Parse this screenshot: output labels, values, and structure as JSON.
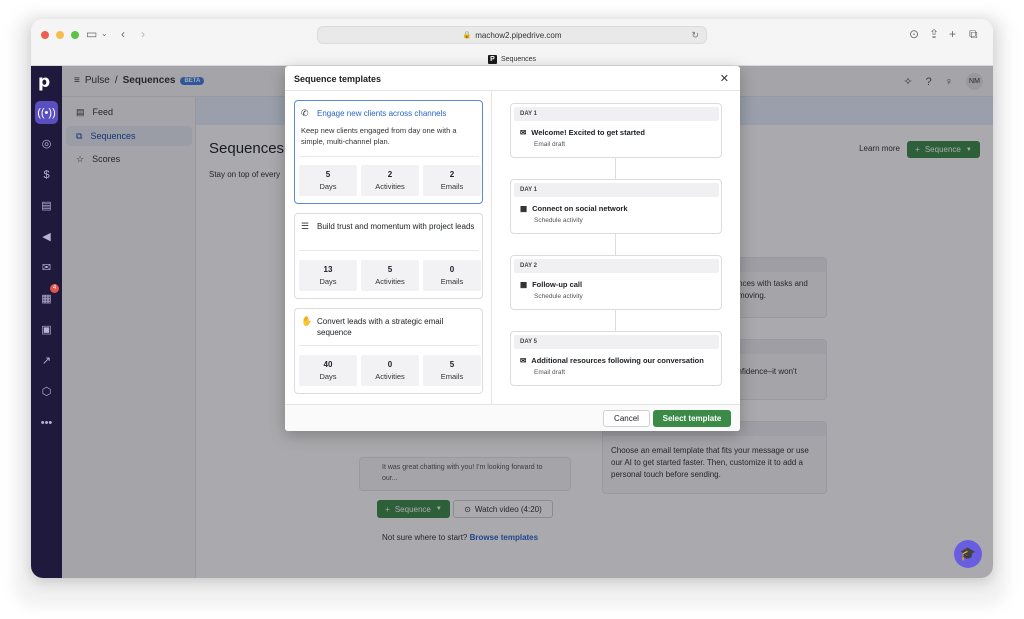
{
  "browser": {
    "url": "machow2.pipedrive.com",
    "tab_title": "Sequences",
    "favicon_letter": "P"
  },
  "colors": {
    "accent": "#3c8a47",
    "rail": "#1f1a3d",
    "link": "#2a63c7"
  },
  "rail": {
    "logo": "p",
    "badge": "4",
    "icons": [
      "pulse-icon",
      "target-icon",
      "dollar-icon",
      "clipboard-icon",
      "megaphone-icon",
      "mail-icon",
      "calendar-icon",
      "contacts-icon",
      "chart-icon",
      "box-icon",
      "more-icon"
    ]
  },
  "header": {
    "app": "Pulse",
    "separator": "/",
    "section": "Sequences",
    "badge": "BETA",
    "avatar": "NM"
  },
  "subnav": {
    "items": [
      {
        "label": "Feed"
      },
      {
        "label": "Sequences"
      },
      {
        "label": "Scores"
      }
    ]
  },
  "main": {
    "title": "Sequences",
    "subtitle": "Stay on top of every",
    "learn_more": "Learn more",
    "new_sequence": "Sequence",
    "card1_text": "nces with tasks and moving.",
    "card2_text": "onfidence–it won't",
    "card3_text": "Choose an email template that fits your message or use our AI to get started faster. Then, customize it to add a personal touch before sending.",
    "preview_text": "It was great chatting with you! I'm looking forward to our...",
    "watch_video": "Watch video (4:20)",
    "not_sure": "Not sure where to start?",
    "browse": "Browse templates"
  },
  "modal": {
    "title": "Sequence templates",
    "templates": [
      {
        "title": "Engage new clients across channels",
        "description": "Keep new clients engaged from day one with a simple, multi-channel plan.",
        "icon": "phone-icon",
        "days": "5",
        "activities": "2",
        "emails": "2"
      },
      {
        "title": "Build trust and momentum with project leads",
        "icon": "checklist-icon",
        "days": "13",
        "activities": "5",
        "emails": "0"
      },
      {
        "title": "Convert leads with a strategic email sequence",
        "icon": "handshake-icon",
        "days": "40",
        "activities": "0",
        "emails": "5"
      }
    ],
    "stat_labels": {
      "days": "Days",
      "activities": "Activities",
      "emails": "Emails"
    },
    "steps": [
      {
        "day": "DAY 1",
        "name": "Welcome! Excited to get started",
        "type": "Email draft",
        "icon": "mail-icon"
      },
      {
        "day": "DAY 1",
        "name": "Connect on social network",
        "type": "Schedule activity",
        "icon": "calendar-icon"
      },
      {
        "day": "DAY 2",
        "name": "Follow-up call",
        "type": "Schedule activity",
        "icon": "calendar-icon"
      },
      {
        "day": "DAY 5",
        "name": "Additional resources following our conversation",
        "type": "Email draft",
        "icon": "mail-icon"
      }
    ],
    "cancel": "Cancel",
    "select": "Select template"
  }
}
